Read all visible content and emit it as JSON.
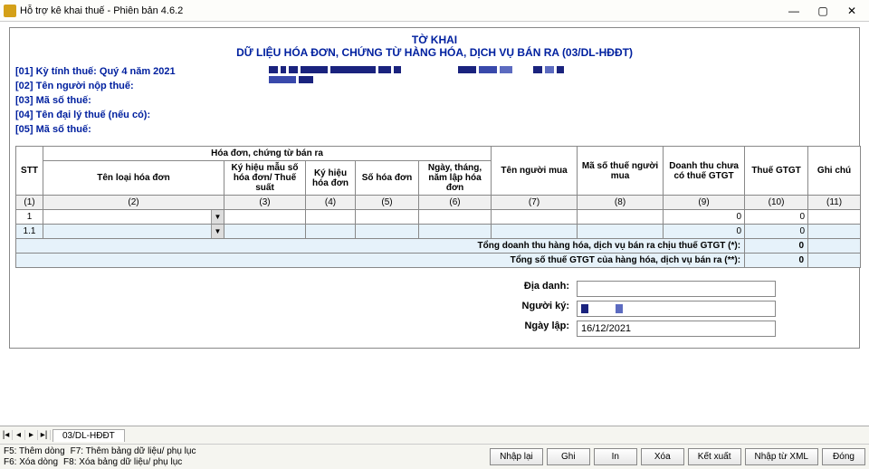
{
  "window": {
    "title": "Hỗ trợ kê khai thuế -  Phiên bản 4.6.2"
  },
  "header": {
    "title": "TỜ  KHAI",
    "subtitle": "DỮ LIỆU HÓA ĐƠN, CHỨNG TỪ HÀNG HÓA, DỊCH VỤ BÁN RA (03/DL-HĐĐT)"
  },
  "info": {
    "r1": "[01]  Kỳ tính thuế: Quý 4 năm 2021",
    "r2": "[02]  Tên người nộp thuế:",
    "r3": "[03]  Mã số thuế:",
    "r4": "[04]  Tên đại lý thuế (nếu có):",
    "r5": "[05]  Mã số thuế:"
  },
  "table": {
    "group1": "Hóa đơn, chứng từ bán ra",
    "h_stt": "STT",
    "h_c2": "Tên loại hóa đơn",
    "h_c3": "Ký hiệu mẫu số hóa đơn/ Thuế suất",
    "h_c4": "Ký hiệu hóa đơn",
    "h_c5": "Số hóa đơn",
    "h_c6": "Ngày, tháng, năm lập hóa đơn",
    "h_c7": "Tên người mua",
    "h_c8": "Mã số thuế người mua",
    "h_c9": "Doanh thu chưa có thuế GTGT",
    "h_c10": "Thuế GTGT",
    "h_c11": "Ghi chú",
    "idx": {
      "c1": "(1)",
      "c2": "(2)",
      "c3": "(3)",
      "c4": "(4)",
      "c5": "(5)",
      "c6": "(6)",
      "c7": "(7)",
      "c8": "(8)",
      "c9": "(9)",
      "c10": "(10)",
      "c11": "(11)"
    },
    "row1": {
      "stt": "1",
      "c9": "0",
      "c10": "0"
    },
    "row1_1": {
      "stt": "1.1",
      "c9": "0",
      "c10": "0"
    },
    "sum1_label": "Tổng doanh thu hàng hóa, dịch vụ bán ra chịu thuế GTGT (*):",
    "sum1_val": "0",
    "sum2_label": "Tổng số thuế GTGT của hàng hóa, dịch vụ bán ra (**):",
    "sum2_val": "0"
  },
  "sign": {
    "diadanh_lbl": "Địa danh:",
    "diadanh_val": "",
    "nguoiky_lbl": "Người ký:",
    "nguoiky_val": "",
    "ngaylap_lbl": "Ngày lập:",
    "ngaylap_val": "16/12/2021"
  },
  "tabs": {
    "tab1": "03/DL-HĐĐT"
  },
  "shortcuts": {
    "f5": "F5: Thêm dòng",
    "f6": "F6: Xóa dòng",
    "f7": "F7: Thêm bảng dữ liệu/ phụ lục",
    "f8": "F8: Xóa bảng dữ liệu/ phụ lục"
  },
  "buttons": {
    "nhaplai": "Nhập lại",
    "ghi": "Ghi",
    "in": "In",
    "xoa": "Xóa",
    "ketxuat": "Kết xuất",
    "nhaptuxml": "Nhập từ XML",
    "dong": "Đóng"
  }
}
